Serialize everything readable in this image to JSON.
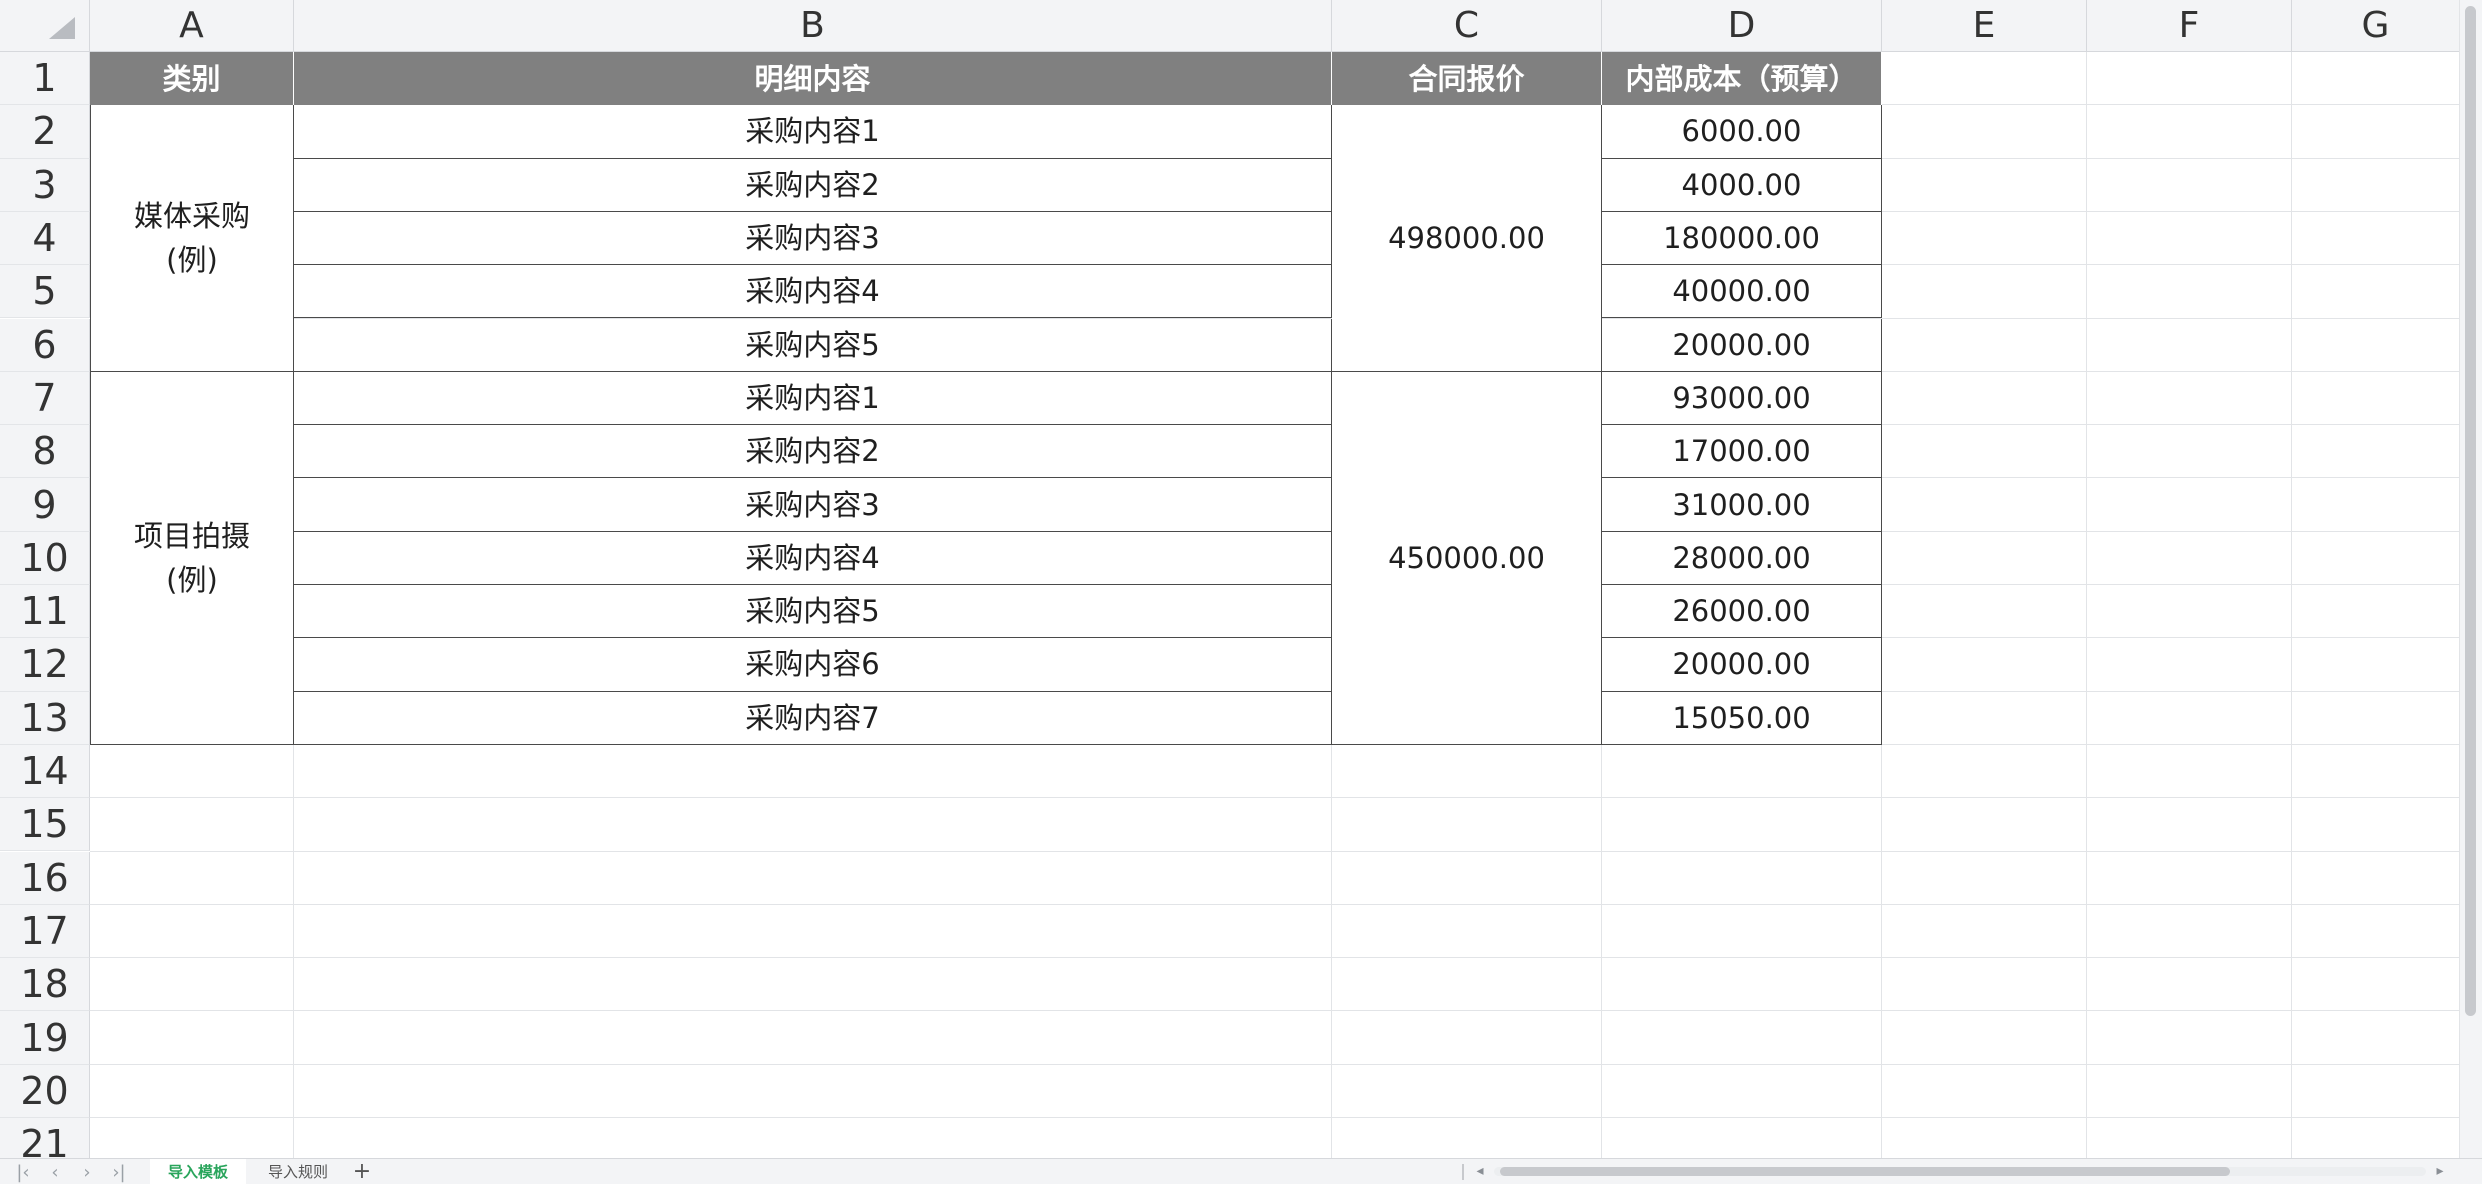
{
  "columns": [
    "A",
    "B",
    "C",
    "D",
    "E",
    "F",
    "G"
  ],
  "rows": [
    "1",
    "2",
    "3",
    "4",
    "5",
    "6",
    "7",
    "8",
    "9",
    "10",
    "11",
    "12",
    "13",
    "14",
    "15",
    "16",
    "17",
    "18",
    "19",
    "20",
    "21"
  ],
  "table": {
    "headers": {
      "category": "类别",
      "detail": "明细内容",
      "contract_price": "合同报价",
      "internal_cost": "内部成本（预算）"
    },
    "groups": [
      {
        "category_line1": "媒体采购",
        "category_line2": "(例)",
        "contract_price": "498000.00",
        "items": [
          {
            "detail": "采购内容1",
            "cost": "6000.00"
          },
          {
            "detail": "采购内容2",
            "cost": "4000.00"
          },
          {
            "detail": "采购内容3",
            "cost": "180000.00"
          },
          {
            "detail": "采购内容4",
            "cost": "40000.00"
          },
          {
            "detail": "采购内容5",
            "cost": "20000.00"
          }
        ]
      },
      {
        "category_line1": "项目拍摄",
        "category_line2": "(例)",
        "contract_price": "450000.00",
        "items": [
          {
            "detail": "采购内容1",
            "cost": "93000.00"
          },
          {
            "detail": "采购内容2",
            "cost": "17000.00"
          },
          {
            "detail": "采购内容3",
            "cost": "31000.00"
          },
          {
            "detail": "采购内容4",
            "cost": "28000.00"
          },
          {
            "detail": "采购内容5",
            "cost": "26000.00"
          },
          {
            "detail": "采购内容6",
            "cost": "20000.00"
          },
          {
            "detail": "采购内容7",
            "cost": "15050.00"
          }
        ]
      }
    ]
  },
  "sheet_tabs": [
    {
      "label": "导入模板",
      "active": true
    },
    {
      "label": "导入规则",
      "active": false
    }
  ],
  "add_sheet_label": "+",
  "colors": {
    "header_bg": "#808080",
    "active_tab": "#2aa55c",
    "grid": "#e2e4e7"
  }
}
